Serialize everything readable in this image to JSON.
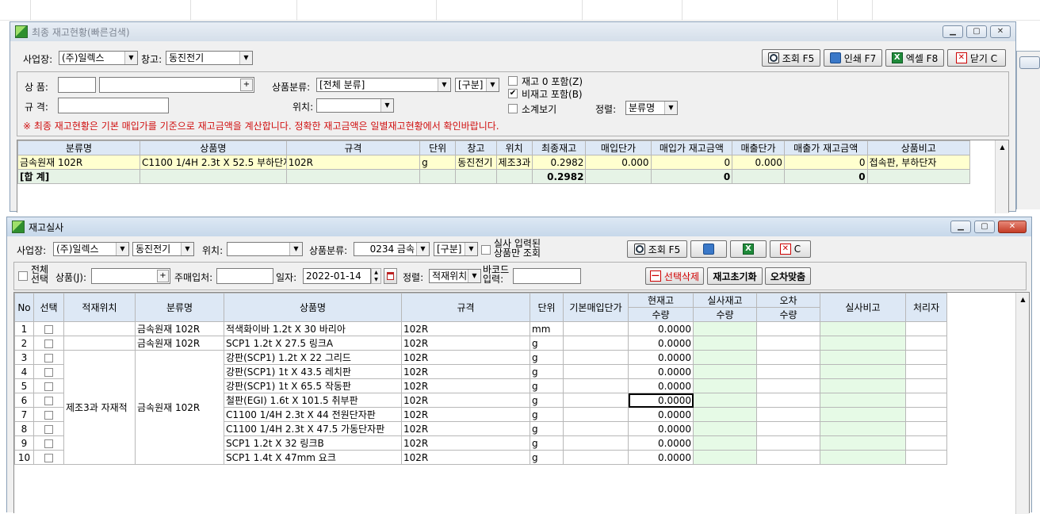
{
  "win1": {
    "title": "최종 재고현황(빠른검색)",
    "site_label": "사업장:",
    "site_value": "(주)일렉스",
    "wh_label": "창고:",
    "wh_value": "동진전기",
    "buttons": {
      "query": "조회 F5",
      "print": "인쇄 F7",
      "excel": "엑셀 F8",
      "close": "닫기 C"
    },
    "product_label": "상  품:",
    "spec_label": "규  격:",
    "category_label": "상품분류:",
    "category_value": "[전체 분류]",
    "gubun_value": "[구분]",
    "location_label": "위치:",
    "cb_zero": "재고 0 포함(Z)",
    "cb_nonstock": "비재고 포함(B)",
    "cb_subtotal": "소계보기",
    "sort_label": "정렬:",
    "sort_value": "분류명",
    "cb_zero_checked": false,
    "cb_nonstock_checked": true,
    "cb_subtotal_checked": false,
    "notice": "※ 최종 재고현황은 기본 매입가를 기준으로 재고금액을 계산합니다. 정확한 재고금액은 일별재고현황에서 확인바랍니다.",
    "columns": [
      "분류명",
      "상품명",
      "규격",
      "단위",
      "창고",
      "위치",
      "최종재고",
      "매입단가",
      "매입가 재고금액",
      "매출단가",
      "매출가 재고금액",
      "상품비고"
    ],
    "rows": [
      [
        "금속원재 102R",
        "C1100 1/4H 2.3t X 52.5 부하단자",
        "102R",
        "g",
        "동진전기",
        "제조3과",
        "0.2982",
        "0.000",
        "0",
        "0.000",
        "0",
        "접속판, 부하단자"
      ]
    ],
    "total": [
      "[합 계]",
      "",
      "",
      "",
      "",
      "",
      "0.2982",
      "",
      "0",
      "",
      "0",
      ""
    ]
  },
  "win2": {
    "title": "재고실사",
    "site_label": "사업장:",
    "site_value": "(주)일렉스",
    "wh_value": "동진전기",
    "location_label": "위치:",
    "category_label": "상품분류:",
    "category_value": "0234 금속",
    "gubun_value": "[구분]",
    "cb_real_l1": "실사 입력된",
    "cb_real_l2": "상품만 조회",
    "btn_query": "조회 F5",
    "btn_close": "C",
    "cb_all_l1": "전체",
    "cb_all_l2": "선택",
    "product_label": "상품(J):",
    "vendor_label": "주매입처:",
    "date_label": "일자:",
    "date_value": "2022-01-14",
    "sort_label": "정렬:",
    "sort_value": "적재위치",
    "barcode_l1": "바코드",
    "barcode_l2": "입력:",
    "btn_delete": "선택삭제",
    "btn_reset": "재고초기화",
    "btn_adjust": "오차맞춤",
    "headers_top": [
      "No",
      "선택",
      "적재위치",
      "분류명",
      "상품명",
      "규격",
      "단위",
      "기본매입단가",
      "현재고",
      "실사재고",
      "오차",
      "실사비고",
      "처리자"
    ],
    "headers_sub": [
      "수량",
      "수량",
      "수량"
    ],
    "group_location": "제조3과 자재적",
    "group_category": "금속원재 102R",
    "rows": [
      {
        "no": "1",
        "location": "",
        "category": "금속원재 102R",
        "name": "적색화이바 1.2t X 30 바리아",
        "spec": "102R",
        "unit": "mm",
        "qty": "0.0000"
      },
      {
        "no": "2",
        "location": "",
        "category": "금속원재 102R",
        "name": "SCP1 1.2t X 27.5 링크A",
        "spec": "102R",
        "unit": "g",
        "qty": "0.0000"
      },
      {
        "no": "3",
        "name": "강판(SCP1) 1.2t X 22 그리드",
        "spec": "102R",
        "unit": "g",
        "qty": "0.0000"
      },
      {
        "no": "4",
        "name": "강판(SCP1) 1t X 43.5 레치판",
        "spec": "102R",
        "unit": "g",
        "qty": "0.0000"
      },
      {
        "no": "5",
        "name": "강판(SCP1) 1t X 65.5 작동판",
        "spec": "102R",
        "unit": "g",
        "qty": "0.0000"
      },
      {
        "no": "6",
        "name": "철판(EGI) 1.6t X 101.5 취부판",
        "spec": "102R",
        "unit": "g",
        "qty": "0.0000"
      },
      {
        "no": "7",
        "name": "C1100 1/4H 2.3t X 44 전원단자판",
        "spec": "102R",
        "unit": "g",
        "qty": "0.0000"
      },
      {
        "no": "8",
        "name": "C1100 1/4H 2.3t X 47.5 가동단자판",
        "spec": "102R",
        "unit": "g",
        "qty": "0.0000"
      },
      {
        "no": "9",
        "name": "SCP1 1.2t X 32 링크B",
        "spec": "102R",
        "unit": "g",
        "qty": "0.0000"
      },
      {
        "no": "10",
        "name": "SCP1 1.4t X 47mm 요크",
        "spec": "102R",
        "unit": "g",
        "qty": "0.0000"
      }
    ]
  },
  "icons": [
    "app-icon",
    "minimize-icon",
    "maximize-icon",
    "close-icon",
    "search-icon",
    "printer-icon",
    "excel-icon",
    "close-doc-icon",
    "calendar-icon"
  ]
}
